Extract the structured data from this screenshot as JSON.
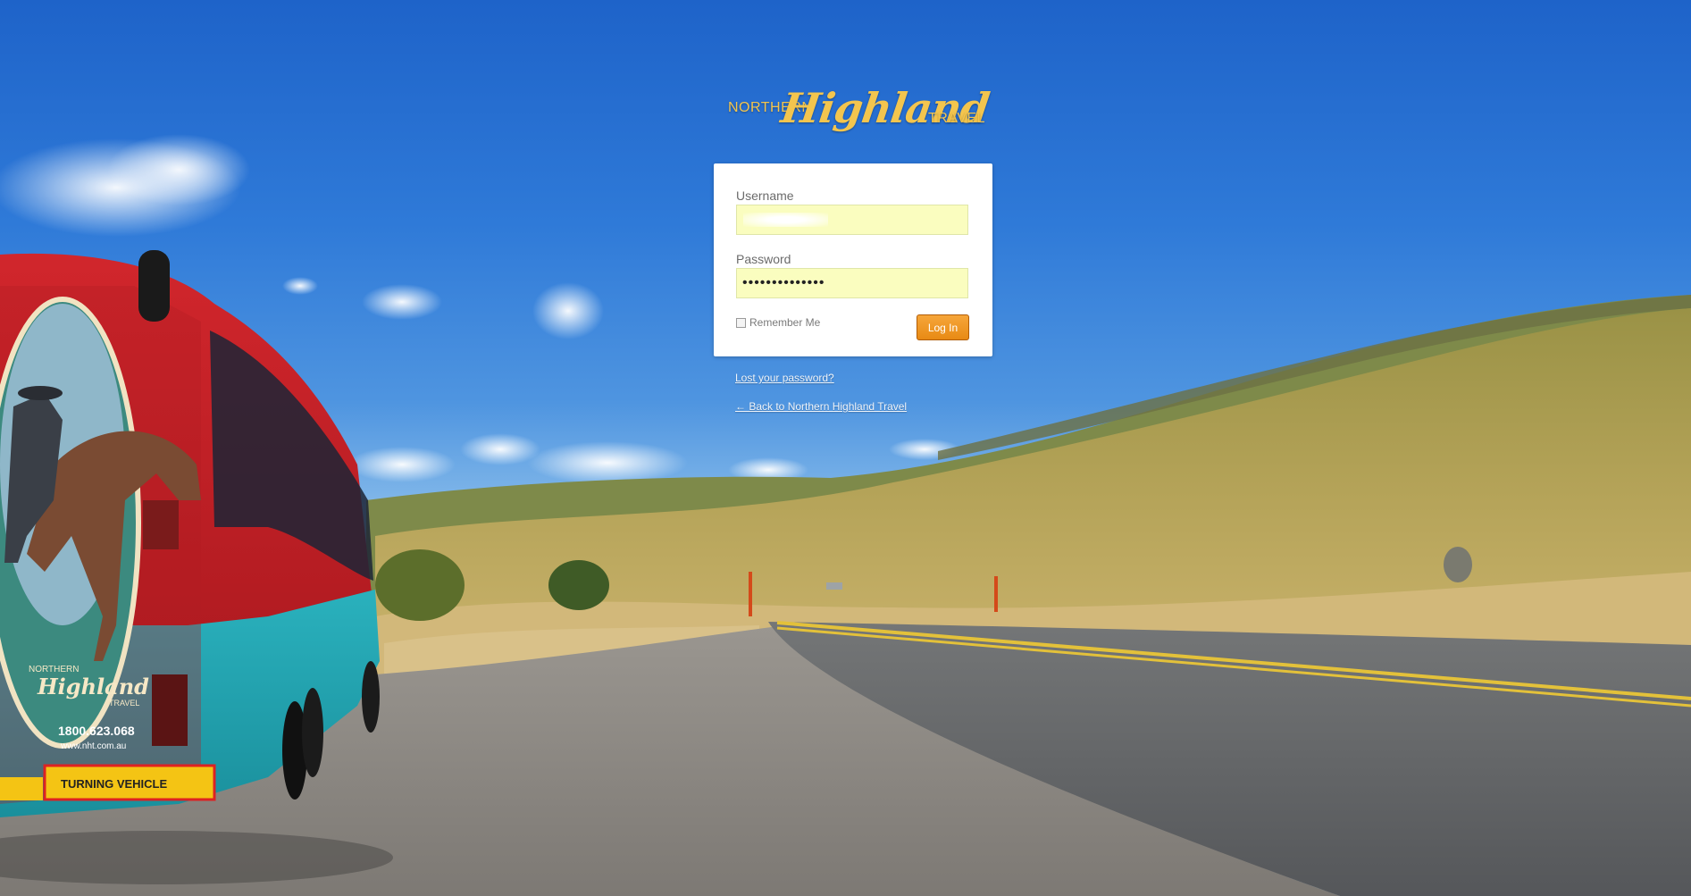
{
  "logo": {
    "northern": "NORTHERN",
    "highland": "Highland",
    "travel": "TRAVEL"
  },
  "login": {
    "username_label": "Username",
    "username_value": "",
    "password_label": "Password",
    "password_value": "••••••••••••••",
    "remember_label": "Remember Me",
    "remember_checked": false,
    "submit_label": "Log In"
  },
  "links": {
    "lost_password": "Lost your password?",
    "back_to_site": "← Back to Northern Highland Travel"
  },
  "bus": {
    "brand_northern": "NORTHERN",
    "brand_highland": "Highland",
    "brand_travel": "TRAVEL",
    "phone": "1800.623.068",
    "website": "www.nht.com.au",
    "warning": "TURNING VEHICLE"
  },
  "colors": {
    "accent": "#e88a14",
    "input_autofill": "#fafdbf",
    "logo_gold": "#f3c54e"
  }
}
